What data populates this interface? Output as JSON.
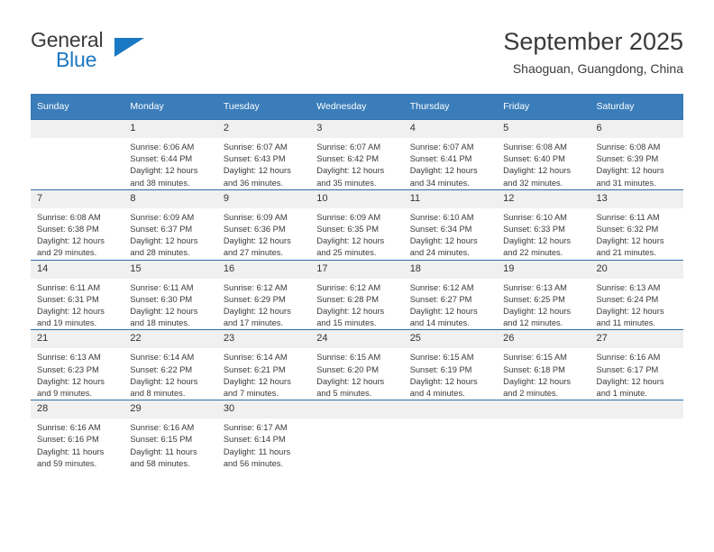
{
  "branding": {
    "name_part1": "General",
    "name_part2": "Blue"
  },
  "header": {
    "title": "September 2025",
    "location": "Shaoguan, Guangdong, China"
  },
  "colors": {
    "header_blue": "#3a7dba",
    "logo_blue": "#1b78c2",
    "daynum_band": "#f0f0f0",
    "row_divider": "#2f6ea5"
  },
  "weekday_headers": [
    "Sunday",
    "Monday",
    "Tuesday",
    "Wednesday",
    "Thursday",
    "Friday",
    "Saturday"
  ],
  "weeks": [
    [
      {
        "day": "",
        "sunrise": "",
        "sunset": "",
        "daylight1": "",
        "daylight2": ""
      },
      {
        "day": "1",
        "sunrise": "Sunrise: 6:06 AM",
        "sunset": "Sunset: 6:44 PM",
        "daylight1": "Daylight: 12 hours",
        "daylight2": "and 38 minutes."
      },
      {
        "day": "2",
        "sunrise": "Sunrise: 6:07 AM",
        "sunset": "Sunset: 6:43 PM",
        "daylight1": "Daylight: 12 hours",
        "daylight2": "and 36 minutes."
      },
      {
        "day": "3",
        "sunrise": "Sunrise: 6:07 AM",
        "sunset": "Sunset: 6:42 PM",
        "daylight1": "Daylight: 12 hours",
        "daylight2": "and 35 minutes."
      },
      {
        "day": "4",
        "sunrise": "Sunrise: 6:07 AM",
        "sunset": "Sunset: 6:41 PM",
        "daylight1": "Daylight: 12 hours",
        "daylight2": "and 34 minutes."
      },
      {
        "day": "5",
        "sunrise": "Sunrise: 6:08 AM",
        "sunset": "Sunset: 6:40 PM",
        "daylight1": "Daylight: 12 hours",
        "daylight2": "and 32 minutes."
      },
      {
        "day": "6",
        "sunrise": "Sunrise: 6:08 AM",
        "sunset": "Sunset: 6:39 PM",
        "daylight1": "Daylight: 12 hours",
        "daylight2": "and 31 minutes."
      }
    ],
    [
      {
        "day": "7",
        "sunrise": "Sunrise: 6:08 AM",
        "sunset": "Sunset: 6:38 PM",
        "daylight1": "Daylight: 12 hours",
        "daylight2": "and 29 minutes."
      },
      {
        "day": "8",
        "sunrise": "Sunrise: 6:09 AM",
        "sunset": "Sunset: 6:37 PM",
        "daylight1": "Daylight: 12 hours",
        "daylight2": "and 28 minutes."
      },
      {
        "day": "9",
        "sunrise": "Sunrise: 6:09 AM",
        "sunset": "Sunset: 6:36 PM",
        "daylight1": "Daylight: 12 hours",
        "daylight2": "and 27 minutes."
      },
      {
        "day": "10",
        "sunrise": "Sunrise: 6:09 AM",
        "sunset": "Sunset: 6:35 PM",
        "daylight1": "Daylight: 12 hours",
        "daylight2": "and 25 minutes."
      },
      {
        "day": "11",
        "sunrise": "Sunrise: 6:10 AM",
        "sunset": "Sunset: 6:34 PM",
        "daylight1": "Daylight: 12 hours",
        "daylight2": "and 24 minutes."
      },
      {
        "day": "12",
        "sunrise": "Sunrise: 6:10 AM",
        "sunset": "Sunset: 6:33 PM",
        "daylight1": "Daylight: 12 hours",
        "daylight2": "and 22 minutes."
      },
      {
        "day": "13",
        "sunrise": "Sunrise: 6:11 AM",
        "sunset": "Sunset: 6:32 PM",
        "daylight1": "Daylight: 12 hours",
        "daylight2": "and 21 minutes."
      }
    ],
    [
      {
        "day": "14",
        "sunrise": "Sunrise: 6:11 AM",
        "sunset": "Sunset: 6:31 PM",
        "daylight1": "Daylight: 12 hours",
        "daylight2": "and 19 minutes."
      },
      {
        "day": "15",
        "sunrise": "Sunrise: 6:11 AM",
        "sunset": "Sunset: 6:30 PM",
        "daylight1": "Daylight: 12 hours",
        "daylight2": "and 18 minutes."
      },
      {
        "day": "16",
        "sunrise": "Sunrise: 6:12 AM",
        "sunset": "Sunset: 6:29 PM",
        "daylight1": "Daylight: 12 hours",
        "daylight2": "and 17 minutes."
      },
      {
        "day": "17",
        "sunrise": "Sunrise: 6:12 AM",
        "sunset": "Sunset: 6:28 PM",
        "daylight1": "Daylight: 12 hours",
        "daylight2": "and 15 minutes."
      },
      {
        "day": "18",
        "sunrise": "Sunrise: 6:12 AM",
        "sunset": "Sunset: 6:27 PM",
        "daylight1": "Daylight: 12 hours",
        "daylight2": "and 14 minutes."
      },
      {
        "day": "19",
        "sunrise": "Sunrise: 6:13 AM",
        "sunset": "Sunset: 6:25 PM",
        "daylight1": "Daylight: 12 hours",
        "daylight2": "and 12 minutes."
      },
      {
        "day": "20",
        "sunrise": "Sunrise: 6:13 AM",
        "sunset": "Sunset: 6:24 PM",
        "daylight1": "Daylight: 12 hours",
        "daylight2": "and 11 minutes."
      }
    ],
    [
      {
        "day": "21",
        "sunrise": "Sunrise: 6:13 AM",
        "sunset": "Sunset: 6:23 PM",
        "daylight1": "Daylight: 12 hours",
        "daylight2": "and 9 minutes."
      },
      {
        "day": "22",
        "sunrise": "Sunrise: 6:14 AM",
        "sunset": "Sunset: 6:22 PM",
        "daylight1": "Daylight: 12 hours",
        "daylight2": "and 8 minutes."
      },
      {
        "day": "23",
        "sunrise": "Sunrise: 6:14 AM",
        "sunset": "Sunset: 6:21 PM",
        "daylight1": "Daylight: 12 hours",
        "daylight2": "and 7 minutes."
      },
      {
        "day": "24",
        "sunrise": "Sunrise: 6:15 AM",
        "sunset": "Sunset: 6:20 PM",
        "daylight1": "Daylight: 12 hours",
        "daylight2": "and 5 minutes."
      },
      {
        "day": "25",
        "sunrise": "Sunrise: 6:15 AM",
        "sunset": "Sunset: 6:19 PM",
        "daylight1": "Daylight: 12 hours",
        "daylight2": "and 4 minutes."
      },
      {
        "day": "26",
        "sunrise": "Sunrise: 6:15 AM",
        "sunset": "Sunset: 6:18 PM",
        "daylight1": "Daylight: 12 hours",
        "daylight2": "and 2 minutes."
      },
      {
        "day": "27",
        "sunrise": "Sunrise: 6:16 AM",
        "sunset": "Sunset: 6:17 PM",
        "daylight1": "Daylight: 12 hours",
        "daylight2": "and 1 minute."
      }
    ],
    [
      {
        "day": "28",
        "sunrise": "Sunrise: 6:16 AM",
        "sunset": "Sunset: 6:16 PM",
        "daylight1": "Daylight: 11 hours",
        "daylight2": "and 59 minutes."
      },
      {
        "day": "29",
        "sunrise": "Sunrise: 6:16 AM",
        "sunset": "Sunset: 6:15 PM",
        "daylight1": "Daylight: 11 hours",
        "daylight2": "and 58 minutes."
      },
      {
        "day": "30",
        "sunrise": "Sunrise: 6:17 AM",
        "sunset": "Sunset: 6:14 PM",
        "daylight1": "Daylight: 11 hours",
        "daylight2": "and 56 minutes."
      },
      {
        "day": "",
        "sunrise": "",
        "sunset": "",
        "daylight1": "",
        "daylight2": ""
      },
      {
        "day": "",
        "sunrise": "",
        "sunset": "",
        "daylight1": "",
        "daylight2": ""
      },
      {
        "day": "",
        "sunrise": "",
        "sunset": "",
        "daylight1": "",
        "daylight2": ""
      },
      {
        "day": "",
        "sunrise": "",
        "sunset": "",
        "daylight1": "",
        "daylight2": ""
      }
    ]
  ]
}
